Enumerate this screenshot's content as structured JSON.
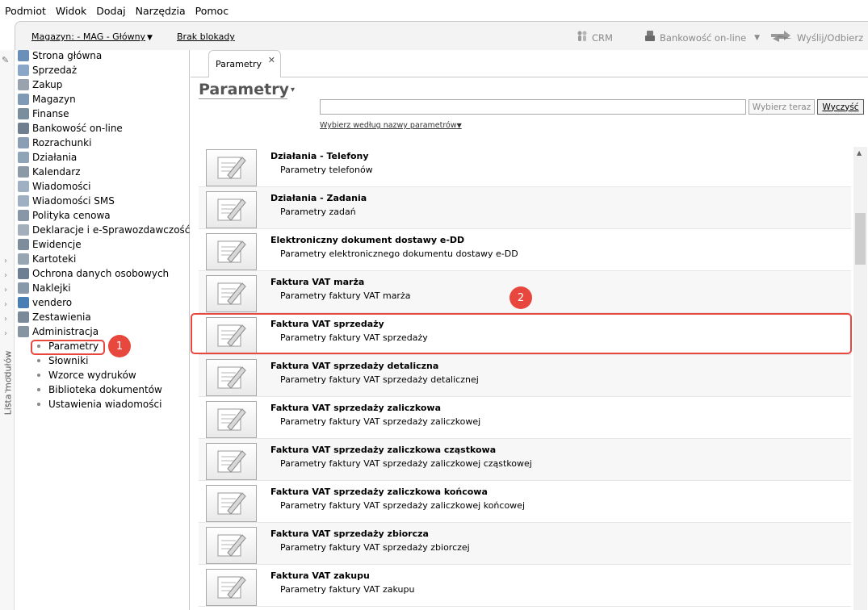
{
  "menu": [
    "Podmiot",
    "Widok",
    "Dodaj",
    "Narzędzia",
    "Pomoc"
  ],
  "toolbar": {
    "warehouse": "Magazyn: - MAG - Główny",
    "lock": "Brak blokady",
    "crm": "CRM",
    "bank": "Bankowość on-line",
    "send": "Wyślij/Odbierz"
  },
  "edge": {
    "label": "Lista modułów"
  },
  "sidebar": {
    "items": [
      {
        "label": "Strona główna",
        "icon": "home-icon",
        "color": "#6a8fb8"
      },
      {
        "label": "Sprzedaż",
        "icon": "sales-icon",
        "color": "#8aa7c8"
      },
      {
        "label": "Zakup",
        "icon": "purchase-icon",
        "color": "#9aa3ad"
      },
      {
        "label": "Magazyn",
        "icon": "warehouse-icon",
        "color": "#7f9ab5"
      },
      {
        "label": "Finanse",
        "icon": "finance-icon",
        "color": "#7a8e9e"
      },
      {
        "label": "Bankowość on-line",
        "icon": "bank-icon",
        "color": "#6f7f8f"
      },
      {
        "label": "Rozrachunki",
        "icon": "settlements-icon",
        "color": "#8a9fb3"
      },
      {
        "label": "Działania",
        "icon": "actions-icon",
        "color": "#90a4b8"
      },
      {
        "label": "Kalendarz",
        "icon": "calendar-icon",
        "color": "#8c9aa8"
      },
      {
        "label": "Wiadomości",
        "icon": "messages-icon",
        "color": "#9fb0c2"
      },
      {
        "label": "Wiadomości SMS",
        "icon": "sms-icon",
        "color": "#9fb0c2"
      },
      {
        "label": "Polityka cenowa",
        "icon": "pricing-icon",
        "color": "#8797a8"
      },
      {
        "label": "Deklaracje i e-Sprawozdawczość",
        "icon": "declarations-icon",
        "color": "#a3afbb"
      },
      {
        "label": "Ewidencje",
        "icon": "records-icon",
        "color": "#7d8d9c"
      },
      {
        "label": "Kartoteki",
        "icon": "files-icon",
        "color": "#98a6b4"
      },
      {
        "label": "Ochrona danych osobowych",
        "icon": "privacy-icon",
        "color": "#6e7f94"
      },
      {
        "label": "Naklejki",
        "icon": "labels-icon",
        "color": "#8899aa"
      },
      {
        "label": "vendero",
        "icon": "vendero-icon",
        "color": "#4a7fb5"
      },
      {
        "label": "Zestawienia",
        "icon": "reports-icon",
        "color": "#7a8a99"
      },
      {
        "label": "Administracja",
        "icon": "admin-icon",
        "color": "#8795a3"
      }
    ],
    "sub_items": [
      "Parametry",
      "Słowniki",
      "Wzorce wydruków",
      "Biblioteka dokumentów",
      "Ustawienia wiadomości"
    ]
  },
  "main": {
    "tab_label": "Parametry",
    "title": "Parametry",
    "search_value": "",
    "btn_choose": "Wybierz teraz",
    "btn_clear": "Wyczyść",
    "choose_by": "Wybierz według nazwy parametrów",
    "rows": [
      {
        "title": "Działania - Telefony",
        "desc": "Parametry telefonów"
      },
      {
        "title": "Działania - Zadania",
        "desc": "Parametry zadań"
      },
      {
        "title": "Elektroniczny dokument dostawy e-DD",
        "desc": "Parametry elektronicznego dokumentu dostawy e-DD"
      },
      {
        "title": "Faktura VAT marża",
        "desc": "Parametry faktury VAT marża"
      },
      {
        "title": "Faktura VAT sprzedaży",
        "desc": "Parametry faktury VAT sprzedaży"
      },
      {
        "title": "Faktura VAT sprzedaży detaliczna",
        "desc": "Parametry faktury VAT sprzedaży detalicznej"
      },
      {
        "title": "Faktura VAT sprzedaży zaliczkowa",
        "desc": "Parametry faktury VAT sprzedaży zaliczkowej"
      },
      {
        "title": "Faktura VAT sprzedaży zaliczkowa cząstkowa",
        "desc": "Parametry faktury VAT sprzedaży zaliczkowej cząstkowej"
      },
      {
        "title": "Faktura VAT sprzedaży zaliczkowa końcowa",
        "desc": "Parametry faktury VAT sprzedaży zaliczkowej końcowej"
      },
      {
        "title": "Faktura VAT sprzedaży zbiorcza",
        "desc": "Parametry faktury VAT sprzedaży zbiorczej"
      },
      {
        "title": "Faktura VAT zakupu",
        "desc": "Parametry faktury VAT zakupu"
      }
    ]
  },
  "annotations": {
    "badge1": "1",
    "badge2": "2",
    "color": "#e8473d"
  }
}
